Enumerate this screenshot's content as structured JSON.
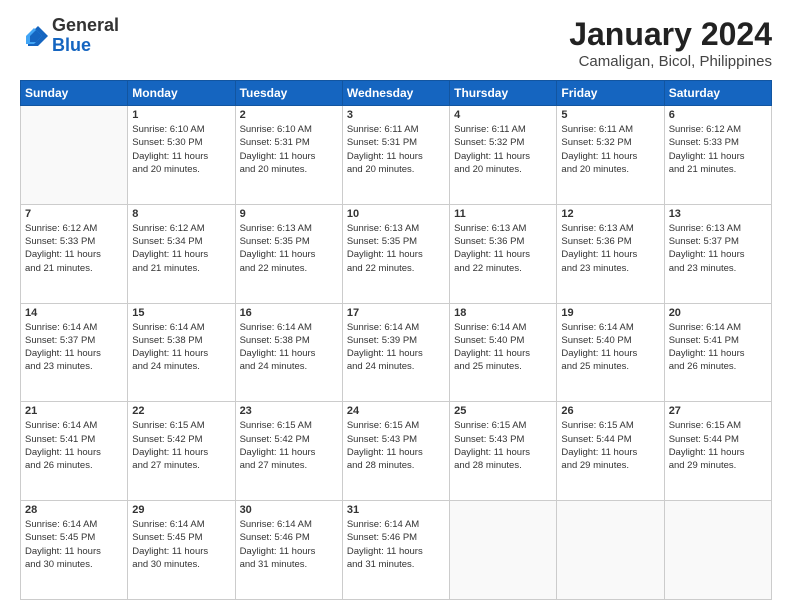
{
  "header": {
    "logo_general": "General",
    "logo_blue": "Blue",
    "main_title": "January 2024",
    "subtitle": "Camaligan, Bicol, Philippines"
  },
  "columns": [
    "Sunday",
    "Monday",
    "Tuesday",
    "Wednesday",
    "Thursday",
    "Friday",
    "Saturday"
  ],
  "weeks": [
    [
      {
        "day": "",
        "info": ""
      },
      {
        "day": "1",
        "info": "Sunrise: 6:10 AM\nSunset: 5:30 PM\nDaylight: 11 hours\nand 20 minutes."
      },
      {
        "day": "2",
        "info": "Sunrise: 6:10 AM\nSunset: 5:31 PM\nDaylight: 11 hours\nand 20 minutes."
      },
      {
        "day": "3",
        "info": "Sunrise: 6:11 AM\nSunset: 5:31 PM\nDaylight: 11 hours\nand 20 minutes."
      },
      {
        "day": "4",
        "info": "Sunrise: 6:11 AM\nSunset: 5:32 PM\nDaylight: 11 hours\nand 20 minutes."
      },
      {
        "day": "5",
        "info": "Sunrise: 6:11 AM\nSunset: 5:32 PM\nDaylight: 11 hours\nand 20 minutes."
      },
      {
        "day": "6",
        "info": "Sunrise: 6:12 AM\nSunset: 5:33 PM\nDaylight: 11 hours\nand 21 minutes."
      }
    ],
    [
      {
        "day": "7",
        "info": "Sunrise: 6:12 AM\nSunset: 5:33 PM\nDaylight: 11 hours\nand 21 minutes."
      },
      {
        "day": "8",
        "info": "Sunrise: 6:12 AM\nSunset: 5:34 PM\nDaylight: 11 hours\nand 21 minutes."
      },
      {
        "day": "9",
        "info": "Sunrise: 6:13 AM\nSunset: 5:35 PM\nDaylight: 11 hours\nand 22 minutes."
      },
      {
        "day": "10",
        "info": "Sunrise: 6:13 AM\nSunset: 5:35 PM\nDaylight: 11 hours\nand 22 minutes."
      },
      {
        "day": "11",
        "info": "Sunrise: 6:13 AM\nSunset: 5:36 PM\nDaylight: 11 hours\nand 22 minutes."
      },
      {
        "day": "12",
        "info": "Sunrise: 6:13 AM\nSunset: 5:36 PM\nDaylight: 11 hours\nand 23 minutes."
      },
      {
        "day": "13",
        "info": "Sunrise: 6:13 AM\nSunset: 5:37 PM\nDaylight: 11 hours\nand 23 minutes."
      }
    ],
    [
      {
        "day": "14",
        "info": "Sunrise: 6:14 AM\nSunset: 5:37 PM\nDaylight: 11 hours\nand 23 minutes."
      },
      {
        "day": "15",
        "info": "Sunrise: 6:14 AM\nSunset: 5:38 PM\nDaylight: 11 hours\nand 24 minutes."
      },
      {
        "day": "16",
        "info": "Sunrise: 6:14 AM\nSunset: 5:38 PM\nDaylight: 11 hours\nand 24 minutes."
      },
      {
        "day": "17",
        "info": "Sunrise: 6:14 AM\nSunset: 5:39 PM\nDaylight: 11 hours\nand 24 minutes."
      },
      {
        "day": "18",
        "info": "Sunrise: 6:14 AM\nSunset: 5:40 PM\nDaylight: 11 hours\nand 25 minutes."
      },
      {
        "day": "19",
        "info": "Sunrise: 6:14 AM\nSunset: 5:40 PM\nDaylight: 11 hours\nand 25 minutes."
      },
      {
        "day": "20",
        "info": "Sunrise: 6:14 AM\nSunset: 5:41 PM\nDaylight: 11 hours\nand 26 minutes."
      }
    ],
    [
      {
        "day": "21",
        "info": "Sunrise: 6:14 AM\nSunset: 5:41 PM\nDaylight: 11 hours\nand 26 minutes."
      },
      {
        "day": "22",
        "info": "Sunrise: 6:15 AM\nSunset: 5:42 PM\nDaylight: 11 hours\nand 27 minutes."
      },
      {
        "day": "23",
        "info": "Sunrise: 6:15 AM\nSunset: 5:42 PM\nDaylight: 11 hours\nand 27 minutes."
      },
      {
        "day": "24",
        "info": "Sunrise: 6:15 AM\nSunset: 5:43 PM\nDaylight: 11 hours\nand 28 minutes."
      },
      {
        "day": "25",
        "info": "Sunrise: 6:15 AM\nSunset: 5:43 PM\nDaylight: 11 hours\nand 28 minutes."
      },
      {
        "day": "26",
        "info": "Sunrise: 6:15 AM\nSunset: 5:44 PM\nDaylight: 11 hours\nand 29 minutes."
      },
      {
        "day": "27",
        "info": "Sunrise: 6:15 AM\nSunset: 5:44 PM\nDaylight: 11 hours\nand 29 minutes."
      }
    ],
    [
      {
        "day": "28",
        "info": "Sunrise: 6:14 AM\nSunset: 5:45 PM\nDaylight: 11 hours\nand 30 minutes."
      },
      {
        "day": "29",
        "info": "Sunrise: 6:14 AM\nSunset: 5:45 PM\nDaylight: 11 hours\nand 30 minutes."
      },
      {
        "day": "30",
        "info": "Sunrise: 6:14 AM\nSunset: 5:46 PM\nDaylight: 11 hours\nand 31 minutes."
      },
      {
        "day": "31",
        "info": "Sunrise: 6:14 AM\nSunset: 5:46 PM\nDaylight: 11 hours\nand 31 minutes."
      },
      {
        "day": "",
        "info": ""
      },
      {
        "day": "",
        "info": ""
      },
      {
        "day": "",
        "info": ""
      }
    ]
  ]
}
